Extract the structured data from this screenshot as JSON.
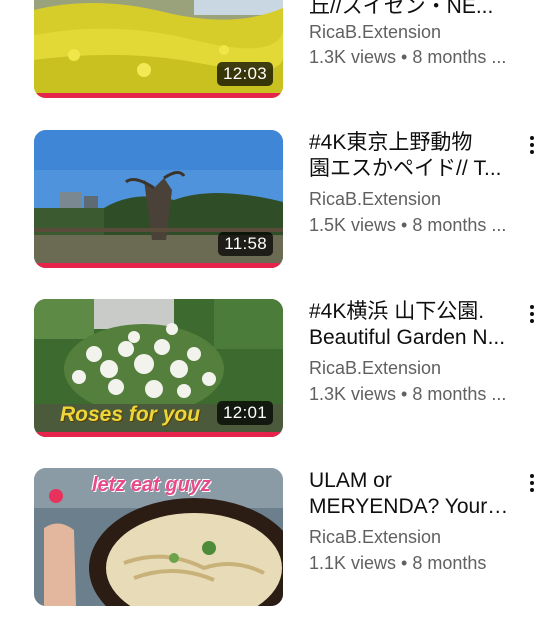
{
  "videos": [
    {
      "title_line1": "丘//スイセン・NE...",
      "title_line2": "",
      "channel": "RicaB.Extension",
      "stats": "1.3K views • 8 months ...",
      "duration": "12:03",
      "progress": 1.0,
      "icons": {
        "menu": "more-vert-icon"
      }
    },
    {
      "title_line1": "#4K東京上野動物",
      "title_line2": "園エスかペイド// T...",
      "channel": "RicaB.Extension",
      "stats": "1.5K views • 8 months ...",
      "duration": "11:58",
      "progress": 1.0,
      "icons": {
        "menu": "more-vert-icon"
      }
    },
    {
      "title_line1": "#4K横浜 山下公園.",
      "title_line2": "Beautiful Garden N...",
      "channel": "RicaB.Extension",
      "stats": "1.3K views • 8 months ...",
      "duration": "12:01",
      "progress": 1.0,
      "thumbnail_caption": "Roses for you",
      "icons": {
        "menu": "more-vert-icon"
      }
    },
    {
      "title_line1": "ULAM or",
      "title_line2": "MERYENDA? Your c...",
      "channel": "RicaB.Extension",
      "stats": "1.1K views • 8 months",
      "thumbnail_caption": "letz eat guyz",
      "icons": {
        "menu": "more-vert-icon"
      }
    }
  ],
  "colors": {
    "progress": "#e6234a",
    "text_primary": "#0f0f0f",
    "text_secondary": "#606060"
  }
}
